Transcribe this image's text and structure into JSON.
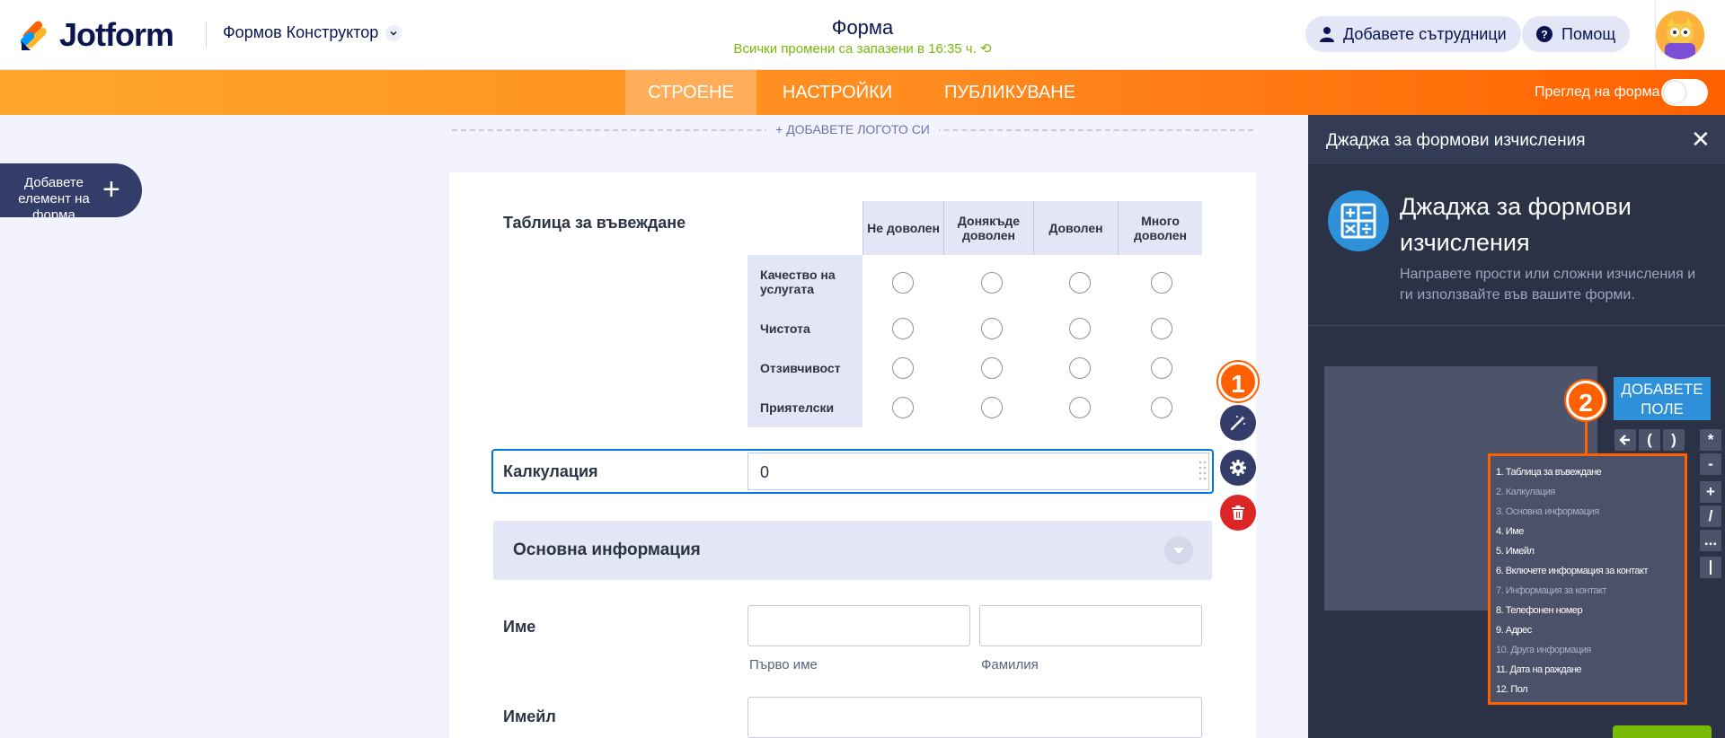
{
  "header": {
    "logo_text": "Jotform",
    "builder_label": "Формов Конструктор",
    "form_title": "Форма",
    "saved_status": "Всички промени са запазени в 16:35 ч.",
    "add_collaborators": "Добавете сътрудници",
    "help": "Помощ"
  },
  "nav": {
    "tabs": [
      {
        "label": "СТРОЕНЕ",
        "active": true
      },
      {
        "label": "НАСТРОЙКИ",
        "active": false
      },
      {
        "label": "ПУБЛИКУВАНЕ",
        "active": false
      }
    ],
    "preview_label": "Преглед на форма"
  },
  "canvas": {
    "add_logo": "+ ДОБАВЕТЕ ЛОГОТО СИ",
    "add_element": "Добавете елемент на форма"
  },
  "form": {
    "matrix_label": "Таблица за въвеждане",
    "matrix_columns": [
      "Не доволен",
      "Донякъде доволен",
      "Доволен",
      "Много доволен"
    ],
    "matrix_rows": [
      "Качество на услугата",
      "Чистота",
      "Отзивчивост",
      "Приятелски"
    ],
    "calc_label": "Калкулация",
    "calc_value": "0",
    "section_title": "Основна информация",
    "name_label": "Име",
    "first_name_sub": "Първо име",
    "last_name_sub": "Фамилия",
    "email_label": "Имейл"
  },
  "annotations": {
    "badge1": "1",
    "badge2": "2"
  },
  "panel": {
    "header_title": "Джаджа за формови изчисления",
    "widget_title": "Джаджа за формови изчисления",
    "widget_desc": "Направете прости или сложни изчисления и ги използвайте във вашите форми.",
    "add_field": "ДОБАВЕТЕ ПОЛЕ",
    "keys": [
      "(",
      ")",
      "*",
      "-",
      "+",
      "/",
      "..."
    ],
    "field_options": [
      {
        "label": "1. Таблица за въвеждане",
        "dim": false
      },
      {
        "label": "2. Калкулация",
        "dim": true
      },
      {
        "label": "3. Основна информация",
        "dim": true
      },
      {
        "label": "4. Име",
        "dim": false
      },
      {
        "label": "5. Имейл",
        "dim": false
      },
      {
        "label": "6. Включете информация за контакт",
        "dim": false
      },
      {
        "label": "7. Информация за контакт",
        "dim": true
      },
      {
        "label": "8. Телефонен номер",
        "dim": false
      },
      {
        "label": "9. Адрес",
        "dim": false
      },
      {
        "label": "10. Друга информация",
        "dim": true
      },
      {
        "label": "11. Дата на раждане",
        "dim": false
      },
      {
        "label": "12. Пол",
        "dim": false
      }
    ]
  },
  "colors": {
    "accent": "#ff6100",
    "brand_blue": "#0075e3",
    "success": "#78bb07"
  }
}
